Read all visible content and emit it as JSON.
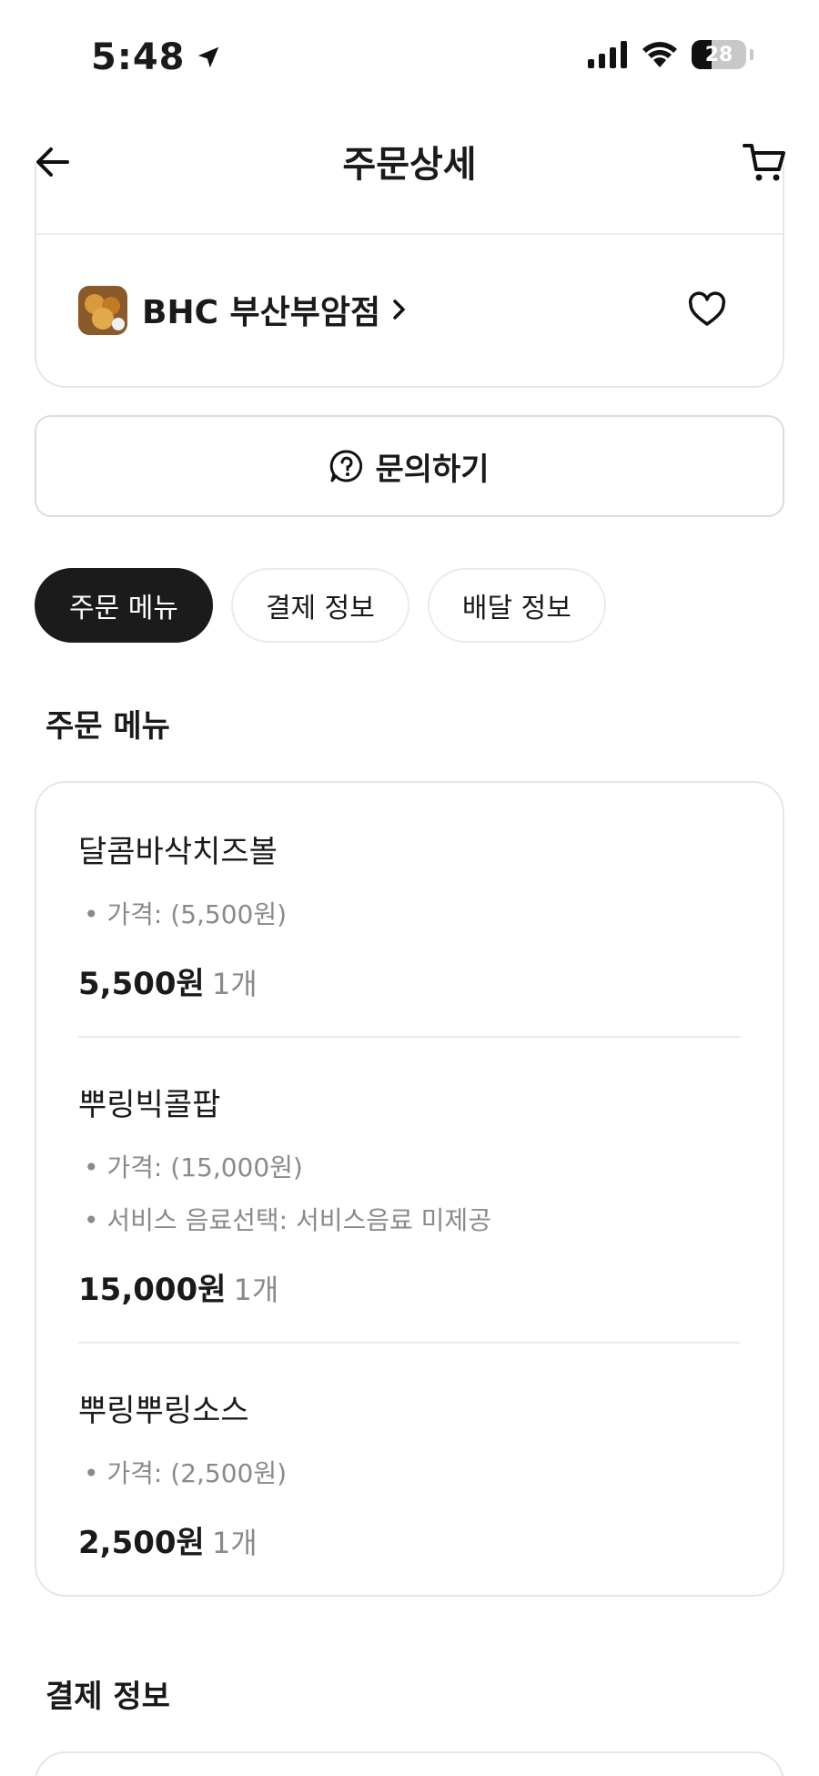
{
  "status_bar": {
    "time": "5:48",
    "battery": "28"
  },
  "nav": {
    "title": "주문상세"
  },
  "store": {
    "name": "BHC 부산부암점",
    "chevron": "›"
  },
  "inquiry": {
    "label": "문의하기"
  },
  "tabs": [
    {
      "label": "주문 메뉴",
      "active": true
    },
    {
      "label": "결제 정보",
      "active": false
    },
    {
      "label": "배달 정보",
      "active": false
    }
  ],
  "order_menu": {
    "title": "주문 메뉴",
    "items": [
      {
        "name": "달콤바삭치즈볼",
        "options": [
          "• 가격:  (5,500원)"
        ],
        "price": "5,500원",
        "qty": "1개"
      },
      {
        "name": "뿌링빅콜팝",
        "options": [
          "• 가격:  (15,000원)",
          "• 서비스 음료선택: 서비스음료 미제공"
        ],
        "price": "15,000원",
        "qty": "1개"
      },
      {
        "name": "뿌링뿌링소스",
        "options": [
          "• 가격:  (2,500원)"
        ],
        "price": "2,500원",
        "qty": "1개"
      }
    ]
  },
  "payment_info": {
    "title": "결제 정보"
  },
  "icons": {
    "back": "arrow-left-icon",
    "cart": "cart-icon",
    "heart": "heart-icon",
    "inquiry": "question-bubble-icon",
    "location": "location-arrow-icon"
  },
  "colors": {
    "active_tab": "#1b1b1b",
    "muted_text": "#8a8a8a",
    "border": "#e6e6e6"
  }
}
